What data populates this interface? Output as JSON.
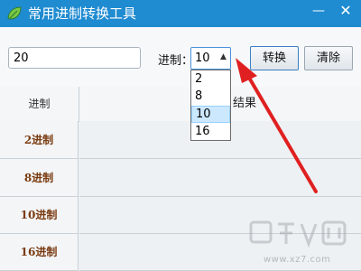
{
  "window": {
    "title": "常用进制转换工具",
    "icon": "app-leaf-icon",
    "controls": [
      "minimize-icon",
      "close-icon"
    ],
    "minimize_glyph": "—",
    "close_glyph": "✕",
    "title_bar_color": "#1f8bd1"
  },
  "toolbar": {
    "value_input": {
      "value": "20",
      "placeholder": ""
    },
    "base_label": "进制：",
    "base_select": {
      "selected": "10",
      "options": [
        "2",
        "8",
        "10",
        "16"
      ]
    },
    "convert_label": "转换",
    "clear_label": "清除"
  },
  "table": {
    "columns": [
      "进制",
      "结果"
    ],
    "rows": [
      {
        "base": "2进制",
        "result": ""
      },
      {
        "base": "8进制",
        "result": ""
      },
      {
        "base": "10进制",
        "result": ""
      },
      {
        "base": "16进制",
        "result": ""
      }
    ]
  },
  "annotation": {
    "arrow_color": "#e02020",
    "icon": "red-arrow-icon"
  },
  "watermark": {
    "url": "www.xz7.com",
    "icon": "xiazaiba-logo-icon"
  }
}
